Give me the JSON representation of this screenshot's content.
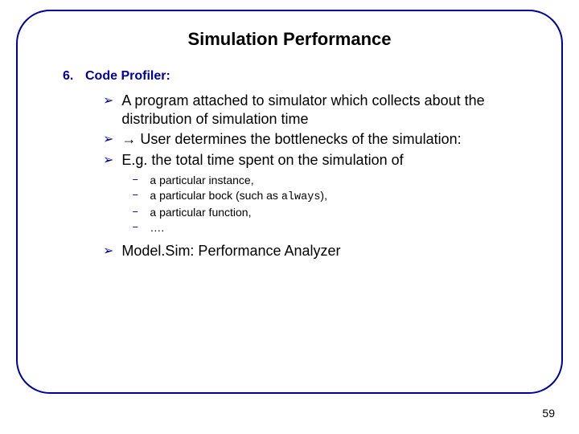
{
  "title": "Simulation Performance",
  "section": {
    "number": "6.",
    "heading": "Code Profiler:"
  },
  "bullets": {
    "b1": "A program attached to simulator which collects about the distribution of simulation time",
    "b2_arrow": "→",
    "b2_text": " User determines the bottlenecks of the simulation:",
    "b3": "E.g. the total time spent on the simulation of",
    "b4": "Model.Sim: Performance Analyzer"
  },
  "dashes": {
    "d1": "a particular instance,",
    "d2_pre": "a particular bock (such as ",
    "d2_code": "always",
    "d2_post": "),",
    "d3": "a particular function,",
    "d4": "…."
  },
  "markers": {
    "triangle": "➢",
    "dash": "–"
  },
  "page_number": "59"
}
